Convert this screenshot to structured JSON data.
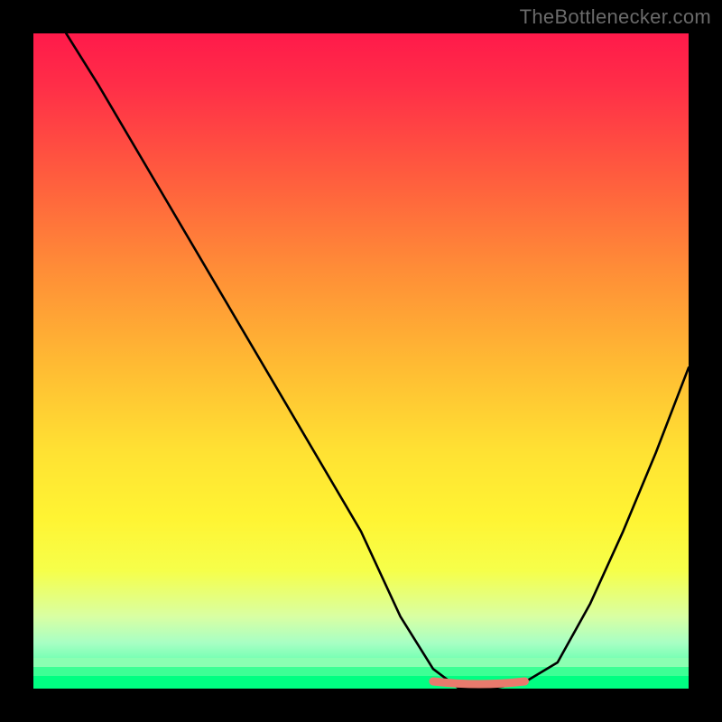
{
  "attribution": "TheBottlenecker.com",
  "chart_data": {
    "type": "line",
    "title": "",
    "xlabel": "",
    "ylabel": "",
    "xlim": [
      0,
      100
    ],
    "ylim": [
      0,
      100
    ],
    "series": [
      {
        "name": "bottleneck-curve",
        "x": [
          5,
          10,
          20,
          30,
          40,
          50,
          56,
          61,
          65,
          70,
          75,
          80,
          85,
          90,
          95,
          100
        ],
        "values": [
          100,
          92,
          75,
          58,
          41,
          24,
          11,
          3,
          0,
          0,
          1,
          4,
          13,
          24,
          36,
          49
        ]
      }
    ],
    "annotation": {
      "name": "trough-marker",
      "color": "#e97a6d",
      "x_range": [
        61,
        75
      ],
      "y": 0
    },
    "background_gradient": {
      "stops": [
        {
          "offset": 0,
          "color": "#ff1a4a"
        },
        {
          "offset": 0.5,
          "color": "#ffe233"
        },
        {
          "offset": 1,
          "color": "#00ff85"
        }
      ]
    }
  }
}
